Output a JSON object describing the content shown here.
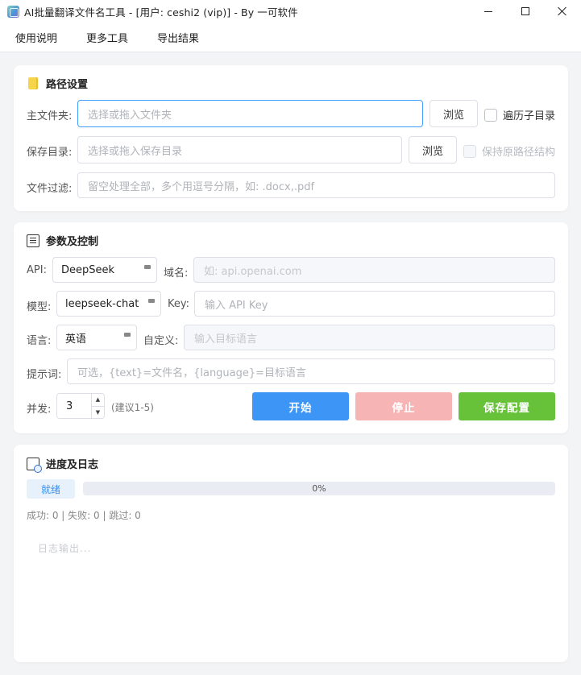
{
  "window": {
    "title": "AI批量翻译文件名工具 - [用户: ceshi2 (vip)] - By 一可软件"
  },
  "menu": {
    "items": [
      "使用说明",
      "更多工具",
      "导出结果"
    ]
  },
  "path_section": {
    "title": "路径设置",
    "main_folder_label": "主文件夹:",
    "main_folder_placeholder": "选择或拖入文件夹",
    "browse_label": "浏览",
    "recurse_label": "遍历子目录",
    "save_dir_label": "保存目录:",
    "save_dir_placeholder": "选择或拖入保存目录",
    "keep_structure_label": "保持原路径结构",
    "filter_label": "文件过滤:",
    "filter_placeholder": "留空处理全部，多个用逗号分隔，如: .docx,.pdf"
  },
  "params_section": {
    "title": "参数及控制",
    "api_label": "API:",
    "api_value": "DeepSeek",
    "domain_label": "域名:",
    "domain_placeholder": "如: api.openai.com",
    "model_label": "模型:",
    "model_value": "leepseek-chat",
    "key_label": "Key:",
    "key_placeholder": "输入 API Key",
    "lang_label": "语言:",
    "lang_value": "英语",
    "custom_label": "自定义:",
    "custom_placeholder": "输入目标语言",
    "prompt_label": "提示词:",
    "prompt_placeholder": "可选，{text}=文件名，{language}=目标语言",
    "concurrency_label": "并发:",
    "concurrency_value": "3",
    "concurrency_hint": "(建议1-5)",
    "start_label": "开始",
    "stop_label": "停止",
    "save_config_label": "保存配置"
  },
  "progress_section": {
    "title": "进度及日志",
    "status": "就绪",
    "progress_text": "0%",
    "progress_value": 0,
    "stats": "成功: 0 | 失败: 0 | 跳过: 0",
    "log_placeholder": "日志输出..."
  },
  "colors": {
    "primary": "#409eff",
    "start": "#3d95f5",
    "stop_disabled": "#f7b4b5",
    "save": "#67c23a"
  }
}
